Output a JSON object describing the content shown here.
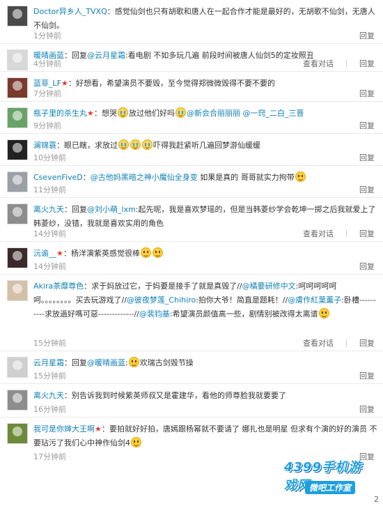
{
  "watermark": {
    "brand": "4399",
    "site": "手机游戏网",
    "tag": "微吧工作室"
  },
  "actions": {
    "view_dialog": "查看对话",
    "reply": "回复"
  },
  "page_indicator": "2",
  "comments": [
    {
      "name": "Doctor异乡人_TVXQ",
      "vip": false,
      "reply": false,
      "text": "感觉仙剑也只有胡歌和唐人在一起合作才能是最好的，无胡歌不仙剑，无唐人不仙剑。",
      "time": "1分钟前",
      "dialog": false,
      "avatar_color": "#4a4a4a"
    },
    {
      "name": "暖晴画蓝",
      "vip": false,
      "reply": true,
      "reply_word": "回复",
      "at": "@云月星霜",
      "text": ":看电剧 不如多玩几遍 前段时间被唐人仙剑5的定妆照丑",
      "time": "4分钟前",
      "dialog": true,
      "avatar_color": "#c9c9c9"
    },
    {
      "name": "蓝菲_LF",
      "vip": true,
      "reply": false,
      "text": "好想看，希望演员不要毁，至今觉得郑微微毁得不要不要的",
      "time": "7分钟前",
      "dialog": false,
      "avatar_color": "#7a3b2e"
    },
    {
      "name": "瓶子里的杀生丸",
      "vip": true,
      "reply": false,
      "text": "想哭",
      "text2": "放过他们好吗",
      "at": "@新会合丽丽丽",
      "at2": "@一窍_二白_三晋",
      "time": "9分钟前",
      "dialog": false,
      "avatar_color": "#6aa36a"
    },
    {
      "name": "澜锦蓑",
      "vip": false,
      "reply": false,
      "text": "眼已瞎，求放过",
      "text2": "吓得我赶紧听几遍回梦游仙缓缓",
      "time": "10分钟前",
      "dialog": false,
      "avatar_color": "#222222"
    },
    {
      "name": "CsevenFiveD",
      "vip": false,
      "reply": false,
      "at": "@古他妈黑暗之神小魔仙全身变",
      "text": "如果是真的 哥哥就实力拘带",
      "time": "11分钟前",
      "dialog": false,
      "avatar_color": "#9aa0a6"
    },
    {
      "name": "离火九天",
      "vip": false,
      "reply": true,
      "reply_word": "回复",
      "at": "@刘小萌_lxm",
      "text": ":起先呢，我是喜欢梦瑶的，但是当韩菱纱学会乾坤一掷之后我就爱上了韩菱纱，没错，我就是喜欢实用的角色",
      "time": "14分钟前",
      "dialog": true,
      "avatar_color": "#8d8d8d"
    },
    {
      "name": "沅谕__",
      "vip": true,
      "reply": false,
      "text": "杨洋演紫英感觉很棒",
      "time": "14分钟前",
      "dialog": false,
      "avatar_color": "#3a2a2a"
    },
    {
      "name": "Akira茶靡尊色",
      "vip": false,
      "reply": false,
      "text": "求于妈放过它，于妈要是接手了就是真毁了//",
      "at": "@橘要研修中文",
      "text2": ":呵呵呵呵呵呵。。。。。。。。买去玩游戏了//",
      "at2": "@彼夜梦莲_Chihiro",
      "text3": ":拍你大爷！简直是题耗！//",
      "at3": "@膚作紅葉薰子",
      "text4": ":卧槽----------求放過好嗎可惡-------------//",
      "at4": "@裴钧基",
      "text5": ":希望演员颜值高一些，剧情别被改得太离谱",
      "time": "15分钟前",
      "dialog": true,
      "avatar_color": "#d2c1a6"
    },
    {
      "name": "云月星霜",
      "vip": false,
      "reply": true,
      "reply_word": "回复",
      "at": "@暖晴画蓝",
      "text": ":",
      "text2": "欢瑞古剑毁节操",
      "time": "15分钟前",
      "dialog": false,
      "avatar_color": "#cfcfcf"
    },
    {
      "name": "离火九天",
      "vip": false,
      "reply": false,
      "text": "别告诉我到时候紫英师叔又是霍建华，看他的师尊脸我就要要了",
      "time": "16分钟前",
      "dialog": false,
      "avatar_color": "#8d8d8d"
    },
    {
      "name": "我可是你婶大王啊",
      "vip": true,
      "reply": false,
      "text": "要拍就好好拍，唐嫣跟杨幂就不要请了 娜扎也是",
      "text2": "明星 但求有个演的好的演员 不要玷污了我们心中神作仙剑4",
      "time": "17分钟前",
      "dialog": false,
      "avatar_color": "#6c8a3a"
    }
  ]
}
